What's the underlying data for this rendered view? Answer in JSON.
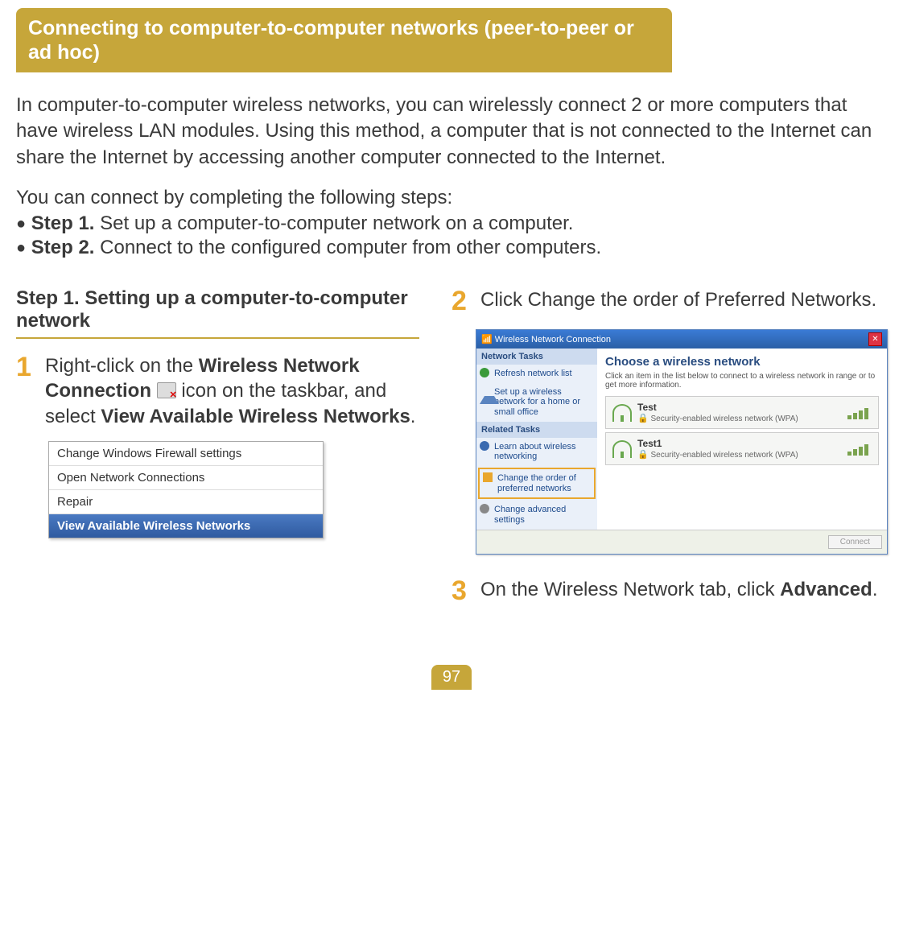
{
  "title": "Connecting to computer-to-computer networks (peer-to-peer or ad hoc)",
  "intro": "In computer-to-computer wireless networks, you can wirelessly connect 2 or more computers that have wireless LAN modules. Using this method, a computer that is not connected to the Internet can share the Internet by accessing another computer connected to the Internet.",
  "steps_intro": "You can connect by completing the following steps:",
  "overview_steps": [
    {
      "label": "Step 1.",
      "text": " Set up a computer-to-computer network on a computer."
    },
    {
      "label": "Step 2.",
      "text": " Connect to the configured computer from other computers."
    }
  ],
  "section_heading": "Step 1. Setting up a computer-to-computer network",
  "step1": {
    "num": "1",
    "pre": "Right-click on the ",
    "bold1": "Wireless Network Connection",
    "mid": " icon on the taskbar, and select ",
    "bold2": "View Available Wireless Networks",
    "post": "."
  },
  "context_menu": [
    "Change Windows Firewall settings",
    "Open Network Connections",
    "Repair",
    "View Available Wireless Networks"
  ],
  "step2": {
    "num": "2",
    "text": "Click Change the order of Preferred Networks."
  },
  "step3": {
    "num": "3",
    "pre": "On the Wireless Network tab, click ",
    "bold": "Advanced",
    "post": "."
  },
  "wireless_window": {
    "title": "Wireless Network Connection",
    "side": {
      "tasks_head": "Network Tasks",
      "tasks": [
        "Refresh network list",
        "Set up a wireless network for a home or small office"
      ],
      "related_head": "Related Tasks",
      "related": [
        "Learn about wireless networking",
        "Change the order of preferred networks",
        "Change advanced settings"
      ]
    },
    "main_head": "Choose a wireless network",
    "main_sub": "Click an item in the list below to connect to a wireless network in range or to get more information.",
    "networks": [
      {
        "name": "Test",
        "sec": "Security-enabled wireless network (WPA)"
      },
      {
        "name": "Test1",
        "sec": "Security-enabled wireless network (WPA)"
      }
    ],
    "connect_btn": "Connect"
  },
  "page_number": "97"
}
